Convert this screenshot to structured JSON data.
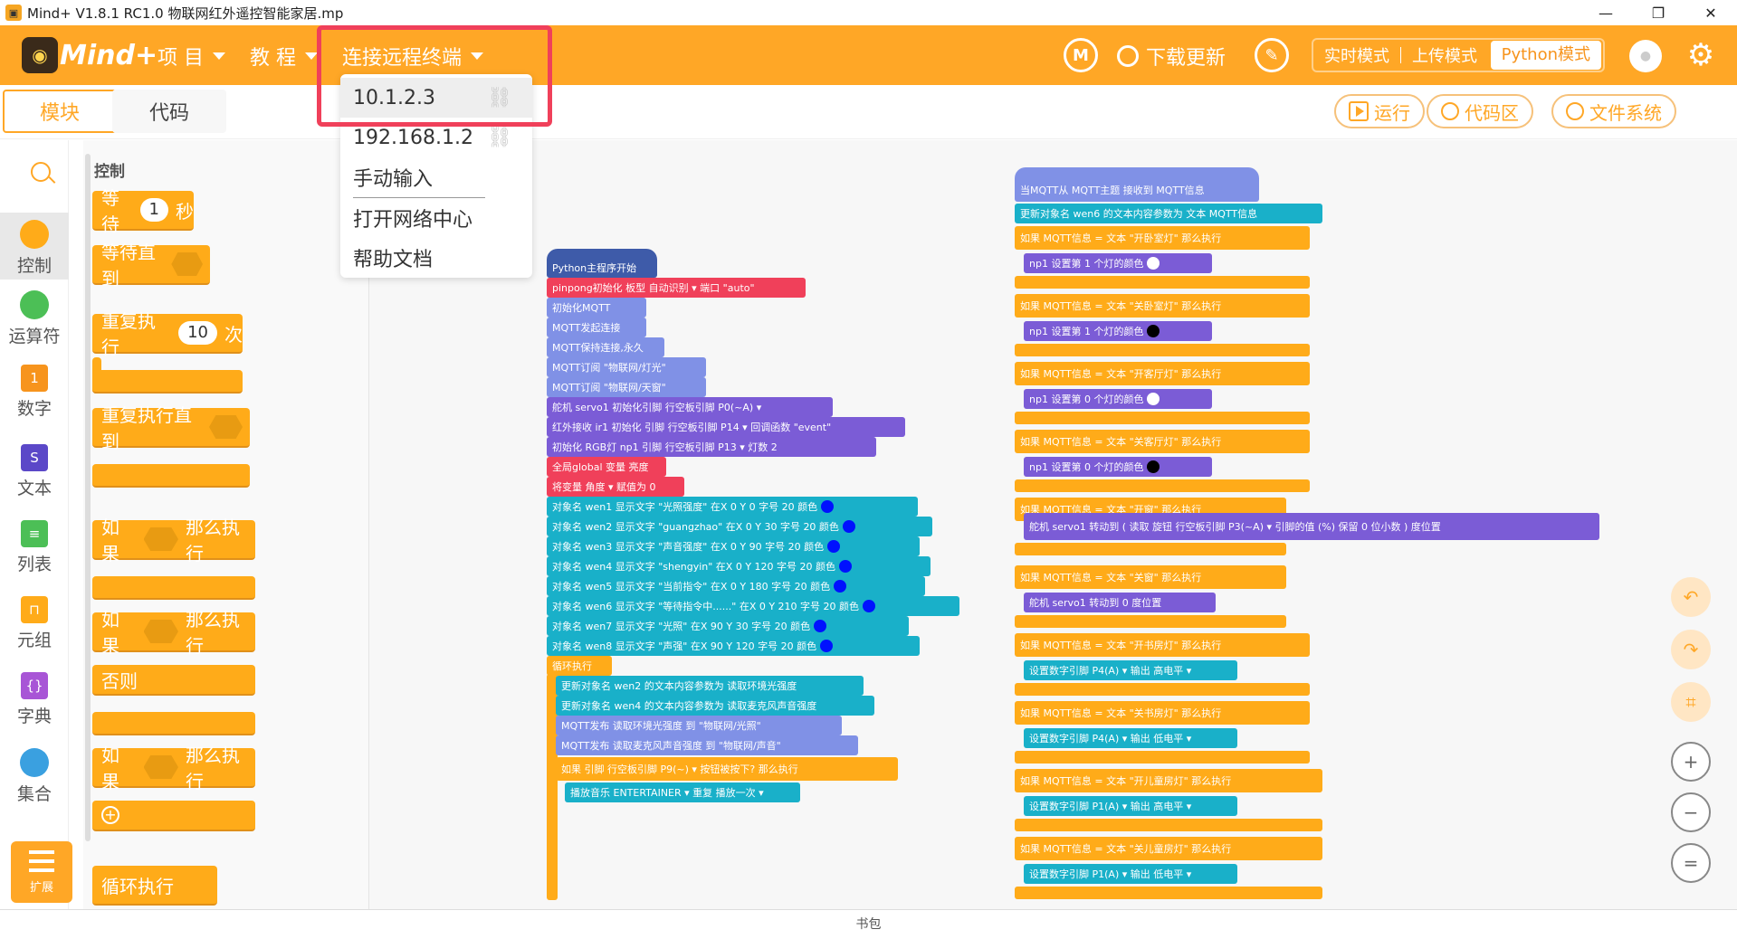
{
  "window": {
    "title": "Mind+ V1.8.1 RC1.0   物联网红外遥控智能家居.mp",
    "minimize": "—",
    "maximize": "❐",
    "close": "✕"
  },
  "header": {
    "brand": "Mind+",
    "menu_project": "项 目",
    "menu_tutorial": "教 程",
    "menu_remote": "连接远程终端",
    "download": "下载更新",
    "mode_realtime": "实时模式",
    "mode_upload": "上传模式",
    "mode_python": "Python模式"
  },
  "remote_dropdown": {
    "items": [
      "10.1.2.3",
      "192.168.1.2",
      "手动输入",
      "打开网络中心",
      "帮助文档"
    ]
  },
  "tabs": {
    "blocks": "模块",
    "code": "代码"
  },
  "toolbar": {
    "run": "运行",
    "code_area": "代码区",
    "file_system": "文件系统"
  },
  "categories": [
    "控制",
    "运算符",
    "数字",
    "文本",
    "列表",
    "元组",
    "字典",
    "集合"
  ],
  "extension": "扩展",
  "palette": {
    "title": "控制",
    "wait": "等待",
    "wait_val": "1",
    "wait_unit": "秒",
    "wait_until": "等待直到",
    "repeat": "重复执行",
    "repeat_val": "10",
    "repeat_unit": "次",
    "repeat_until": "重复执行直到",
    "if1": "如果",
    "then1": "那么执行",
    "if2": "如果",
    "then2": "那么执行",
    "else": "否则",
    "if3": "如果",
    "then3": "那么执行",
    "forever": "循环执行"
  },
  "left_script": {
    "start": "Python主程序开始",
    "pinpong": "pinpong初始化 板型  自动识别 ▾  端口  \"auto\"",
    "init_mqtt": "初始化MQTT",
    "mqtt_connect": "MQTT发起连接",
    "mqtt_keep": "MQTT保持连接,永久",
    "sub1": "MQTT订阅  \"物联网/灯光\"",
    "sub2": "MQTT订阅  \"物联网/天窗\"",
    "servo_init": "舵机 servo1 初始化引脚  行空板引脚  P0(~A) ▾",
    "ir_init": "红外接收 ir1 初始化 引脚  行空板引脚  P14 ▾  回调函数  \"event\"",
    "rgb_init": "初始化 RGB灯 np1 引脚  行空板引脚  P13 ▾  灯数 2",
    "global": "全局global  变量 亮度",
    "angle": "将变量  角度 ▾  赋值为 0",
    "texts": [
      "对象名 wen1 显示文字 \"光照强度\" 在X 0 Y 0 字号 20 颜色",
      "对象名 wen2 显示文字 \"guangzhao\" 在X 0 Y 30 字号 20 颜色",
      "对象名 wen3 显示文字 \"声音强度\" 在X 0 Y 90 字号 20 颜色",
      "对象名 wen4 显示文字 \"shengyin\" 在X 0 Y 120 字号 20 颜色",
      "对象名 wen5 显示文字 \"当前指令\" 在X 0 Y 180 字号 20 颜色",
      "对象名 wen6 显示文字 \"等待指令中......\" 在X 0 Y 210 字号 20 颜色",
      "对象名 wen7 显示文字 \"光照\" 在X 90 Y 30 字号 20 颜色",
      "对象名 wen8 显示文字 \"声强\" 在X 90 Y 120 字号 20 颜色"
    ],
    "loop": "循环执行",
    "upd1": "更新对象名 wen2 的文本内容参数为  读取环境光强度",
    "upd2": "更新对象名 wen4 的文本内容参数为  读取麦克风声音强度",
    "pub1": "MQTT发布  读取环境光强度  到 \"物联网/光照\"",
    "pub2": "MQTT发布  读取麦克风声音强度  到 \"物联网/声音\"",
    "if_btn": "如果  引脚  行空板引脚  P9(~) ▾  按钮被按下?  那么执行",
    "music": "播放音乐  ENTERTAINER ▾  重复  播放一次 ▾"
  },
  "right_script": {
    "hat": "当MQTT从  MQTT主题  接收到  MQTT信息",
    "update": "更新对象名 wen6 的文本内容参数为  文本  MQTT信息",
    "rows": [
      {
        "cond": "如果  MQTT信息 = 文本 \"开卧室灯\"  那么执行",
        "action": "np1 设置第 1 个灯的颜色",
        "color": "white"
      },
      {
        "cond": "如果  MQTT信息 = 文本 \"关卧室灯\"  那么执行",
        "action": "np1 设置第 1 个灯的颜色",
        "color": "black"
      },
      {
        "cond": "如果  MQTT信息 = 文本 \"开客厅灯\"  那么执行",
        "action": "np1 设置第 0 个灯的颜色",
        "color": "white"
      },
      {
        "cond": "如果  MQTT信息 = 文本 \"关客厅灯\"  那么执行",
        "action": "np1 设置第 0 个灯的颜色",
        "color": "black"
      }
    ],
    "open_window": "如果  MQTT信息 = 文本 \"开窗\"  那么执行",
    "servo_map": "舵机 servo1 转动到  (  读取 旋钮  行空板引脚  P3(~A) ▾  引脚的值 (%)  保留 0 位小数 ) 度位置",
    "close_window": "如果  MQTT信息 = 文本 \"关窗\"  那么执行",
    "servo_zero": "舵机 servo1 转动到 0 度位置",
    "pins": [
      {
        "cond": "如果  MQTT信息 = 文本 \"开书房灯\"  那么执行",
        "action": "设置数字引脚  P4(A) ▾  输出  高电平 ▾"
      },
      {
        "cond": "如果  MQTT信息 = 文本 \"关书房灯\"  那么执行",
        "action": "设置数字引脚  P4(A) ▾  输出  低电平 ▾"
      },
      {
        "cond": "如果  MQTT信息 = 文本 \"开儿童房灯\"  那么执行",
        "action": "设置数字引脚  P1(A) ▾  输出  高电平 ▾"
      },
      {
        "cond": "如果  MQTT信息 = 文本 \"关儿童房灯\"  那么执行",
        "action": "设置数字引脚  P1(A) ▾  输出  低电平 ▾"
      }
    ]
  },
  "float_tools": {
    "undo": "↶",
    "redo": "↷",
    "crop": "⌗",
    "zoom_in": "+",
    "zoom_out": "−",
    "reset": "="
  },
  "bottom": "书包"
}
